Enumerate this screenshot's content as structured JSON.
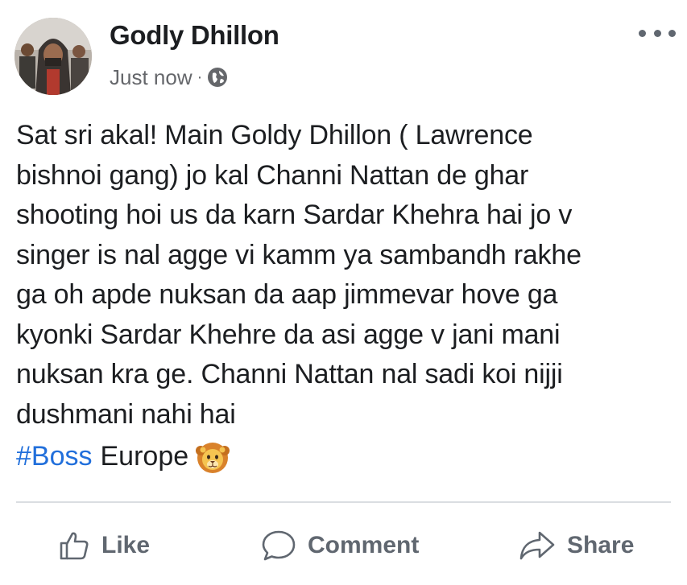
{
  "post": {
    "author": "Godly Dhillon",
    "timestamp": "Just now",
    "separator": "·",
    "privacy_icon": "globe-icon",
    "more_icon": "more-options-icon",
    "body": "Sat sri akal! Main Goldy Dhillon ( Lawrence\nbishnoi gang) jo kal Channi Nattan de ghar\nshooting hoi us da karn Sardar Khehra hai jo v\nsinger is nal agge vi kamm ya sambandh rakhe\nga oh apde nuksan da aap jimmevar hove ga\nkyonki Sardar Khehre da asi agge v jani mani\nnuksan kra ge. Channi Nattan nal sadi koi nijji\ndushmani nahi hai",
    "hashtag": "#Boss",
    "hashtag_suffix": "Europe",
    "emoji_icon": "lion-face-icon"
  },
  "actions": {
    "like_label": "Like",
    "comment_label": "Comment",
    "share_label": "Share"
  },
  "colors": {
    "hashtag": "#216fdb",
    "secondary_text": "#65676b",
    "action_text": "#606770",
    "divider": "#dadde1"
  }
}
